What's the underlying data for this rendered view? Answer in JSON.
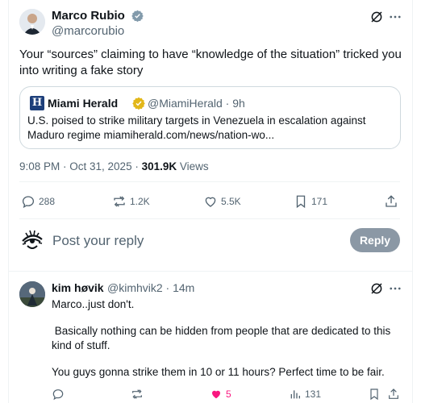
{
  "main_tweet": {
    "author_name": "Marco Rubio",
    "handle": "@marcorubio",
    "text": "Your “sources” claiming to have “knowledge of the situation” tricked you into writing a fake story",
    "quote": {
      "source_name": "Miami Herald",
      "source_rest": "@MiamiHerald · 9h",
      "text": "U.S. poised to strike military targets in Venezuela in escalation against Maduro regime miamiherald.com/news/nation-wo..."
    },
    "timestamp": "9:08 PM · Oct 31, 2025 ·",
    "views_count": "301.9K",
    "views_label": "Views",
    "stats": {
      "replies": "288",
      "reposts": "1.2K",
      "likes": "5.5K",
      "bookmarks": "171"
    }
  },
  "reply_box": {
    "placeholder": "Post your reply",
    "button_label": "Reply"
  },
  "reply_tweet": {
    "author_name": "kim høvik",
    "handle_time": "@kimhvik2 · 14m",
    "line1": "Marco..just don't.",
    "line2": " Basically nothing can be hidden from people that are dedicated to this kind of stuff.",
    "line3": "You guys gonna strike them in 10 or 11 hours? Perfect time to be fair.",
    "stats": {
      "likes": "5",
      "views": "131"
    }
  },
  "colors": {
    "accent": "#1d9bf0",
    "like_pink": "#f91880",
    "muted": "#536471",
    "verified_gold": "#e2b719"
  }
}
